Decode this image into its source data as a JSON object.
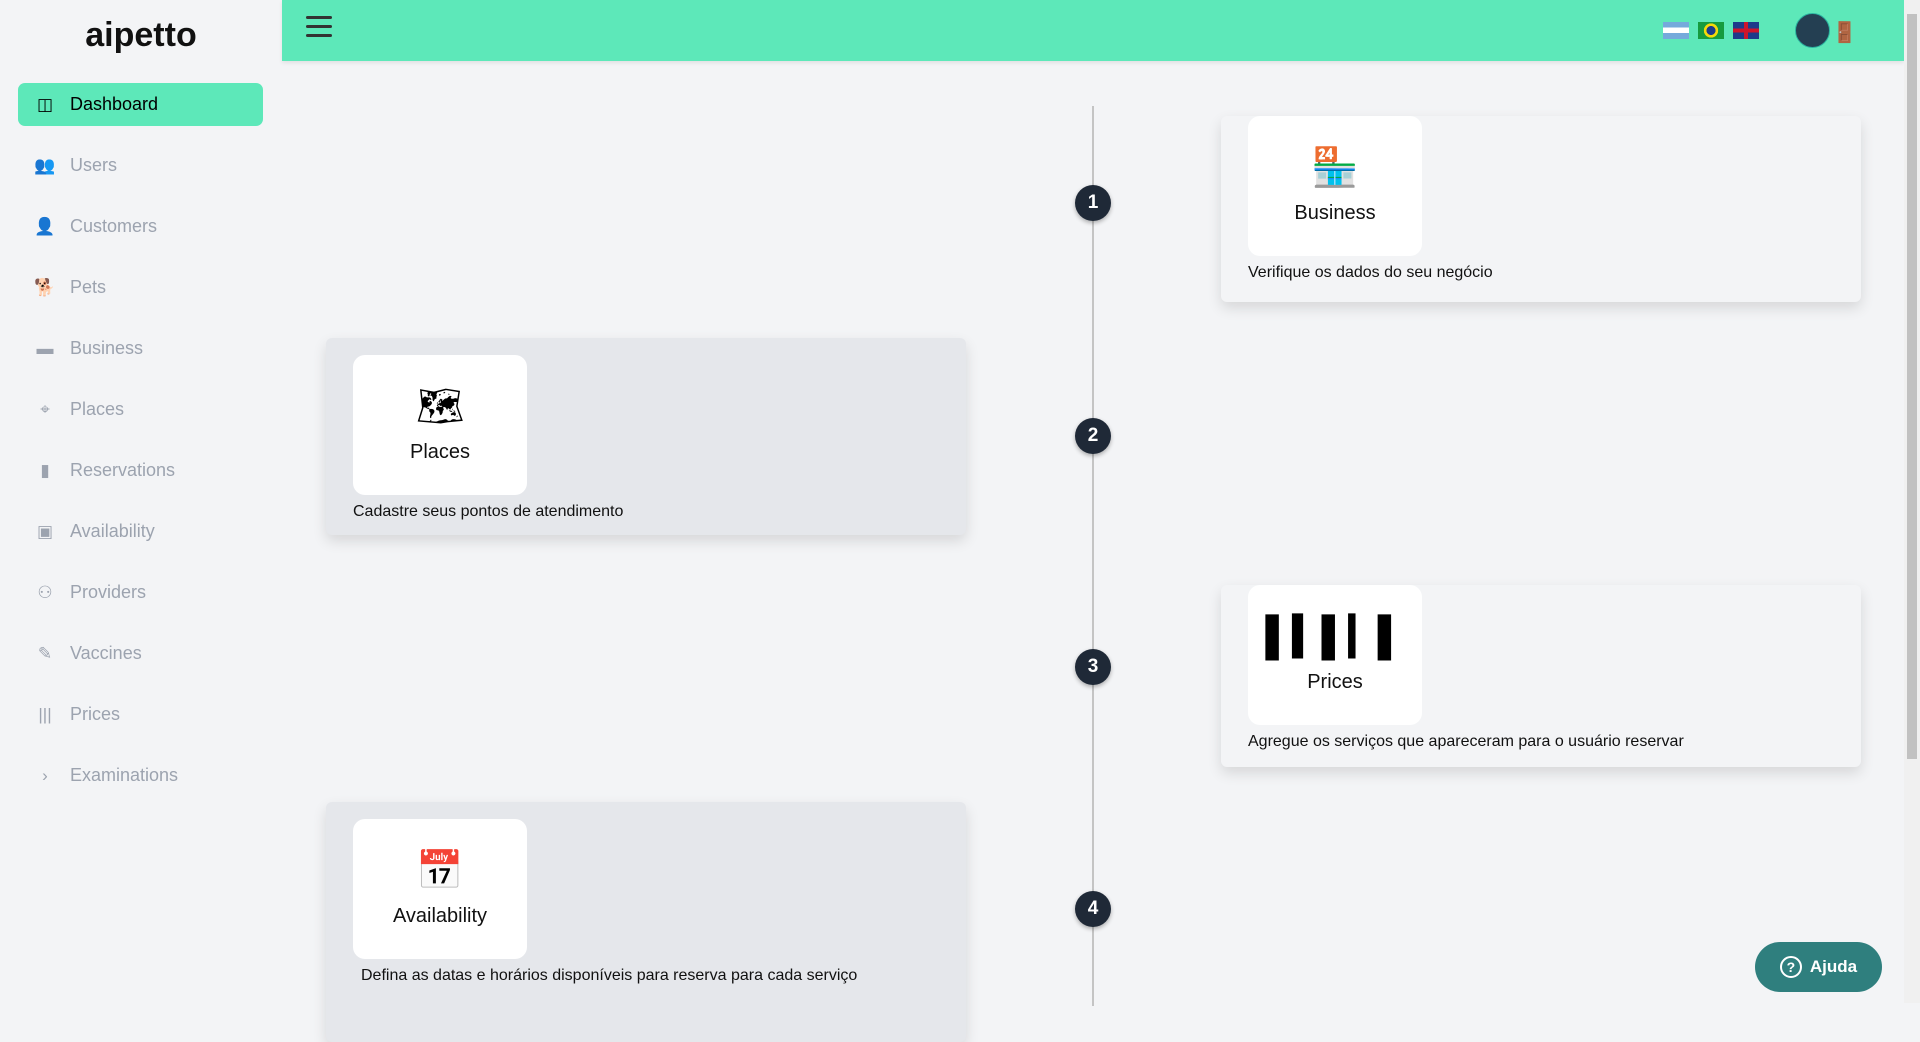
{
  "app": {
    "logo": "aipetto"
  },
  "sidebar": {
    "items": [
      {
        "label": "Dashboard",
        "icon": "columns-icon",
        "glyph": "◫",
        "active": true
      },
      {
        "label": "Users",
        "icon": "users-icon",
        "glyph": "👥"
      },
      {
        "label": "Customers",
        "icon": "user-icon",
        "glyph": "👤"
      },
      {
        "label": "Pets",
        "icon": "dog-icon",
        "glyph": "🐕"
      },
      {
        "label": "Business",
        "icon": "store-icon",
        "glyph": "▬"
      },
      {
        "label": "Places",
        "icon": "map-marked-icon",
        "glyph": "⌖"
      },
      {
        "label": "Reservations",
        "icon": "book-icon",
        "glyph": "▮"
      },
      {
        "label": "Availability",
        "icon": "calendar-check-icon",
        "glyph": "▣"
      },
      {
        "label": "Providers",
        "icon": "people-carry-icon",
        "glyph": "⚇"
      },
      {
        "label": "Vaccines",
        "icon": "syringe-icon",
        "glyph": "✎"
      },
      {
        "label": "Prices",
        "icon": "barcode-icon",
        "glyph": "|||"
      },
      {
        "label": "Examinations",
        "icon": "chevron-right-icon",
        "glyph": "›"
      }
    ]
  },
  "topbar": {
    "languages": [
      "Español (Argentina)",
      "Português (Brasil)",
      "English (UK)"
    ]
  },
  "timeline": {
    "steps": [
      {
        "number": "1",
        "title": "Business",
        "description": "Verifique os dados do seu negócio",
        "icon": "store-icon",
        "glyph": "🏪"
      },
      {
        "number": "2",
        "title": "Places",
        "description": "Cadastre seus pontos de atendimento",
        "icon": "map-marked-icon",
        "glyph": "🗺"
      },
      {
        "number": "3",
        "title": "Prices",
        "description": "Agregue os serviços que apareceram para o usuário reservar",
        "icon": "barcode-icon",
        "glyph": "▌▍▌▎▌"
      },
      {
        "number": "4",
        "title": "Availability",
        "description": "Defina as datas e horários disponíveis para reserva para cada serviço",
        "icon": "calendar-check-icon",
        "glyph": "📅"
      }
    ]
  },
  "help": {
    "label": "Ajuda"
  },
  "colors": {
    "accent": "#5de8b9",
    "step": "#1f2937",
    "help": "#2f7f7e"
  }
}
